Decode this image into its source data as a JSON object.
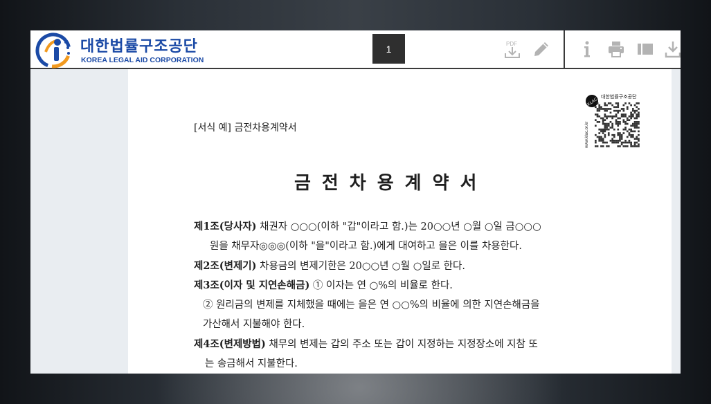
{
  "header": {
    "logo_korean": "대한법률구조공단",
    "logo_english": "KOREA LEGAL AID CORPORATION",
    "page_number": "1"
  },
  "toolbar": {
    "icons": [
      "pdf-download-icon",
      "edit-pencil-icon",
      "info-icon",
      "print-icon",
      "sidebar-toggle-icon",
      "download-icon"
    ],
    "pdf_icon_text": "PDF"
  },
  "document": {
    "form_label": "[서식 예] 금전차용계약서",
    "title": "금전차용계약서",
    "qr_label": "대한법률구조공단",
    "qr_side_text": "www.klac.or.kr",
    "qr_seal_text": "KLAC",
    "clauses": [
      {
        "head": "제1조(당사자)",
        "text": " 채권자 ○○○(이하 \"갑\"이라고 함.)는 20○○년 ○월 ○일 금○○○"
      },
      {
        "head": "",
        "text": "원을 채무자◎◎◎(이하 \"을\"이라고 함.)에게 대여하고 을은 이를 차용한다."
      },
      {
        "head": "제2조(변제기)",
        "text": " 차용금의 변제기한은 20○○년 ○월 ○일로 한다."
      },
      {
        "head": "제3조(이자 및 지연손해금)",
        "text": "  ① 이자는 연 ○%의 비율로 한다."
      },
      {
        "head": "",
        "text": "② 원리금의 변제를 지체했을 때에는 을은 연  ○○%의 비율에 의한 지연손해금을"
      },
      {
        "head": "",
        "text": "가산해서 지불해야 한다."
      },
      {
        "head": "제4조(변제방법)",
        "text": " 채무의 변제는 갑의 주소 또는 갑이 지정하는 지정장소에 지참 또"
      },
      {
        "head": "",
        "text": "는 송금해서 지불한다."
      }
    ]
  },
  "colors": {
    "brand_blue": "#1b4aa6",
    "brand_orange": "#f29a1f",
    "toolbar_icon_gray": "#b3b3b3",
    "page_box_bg": "#2f2f2f"
  }
}
